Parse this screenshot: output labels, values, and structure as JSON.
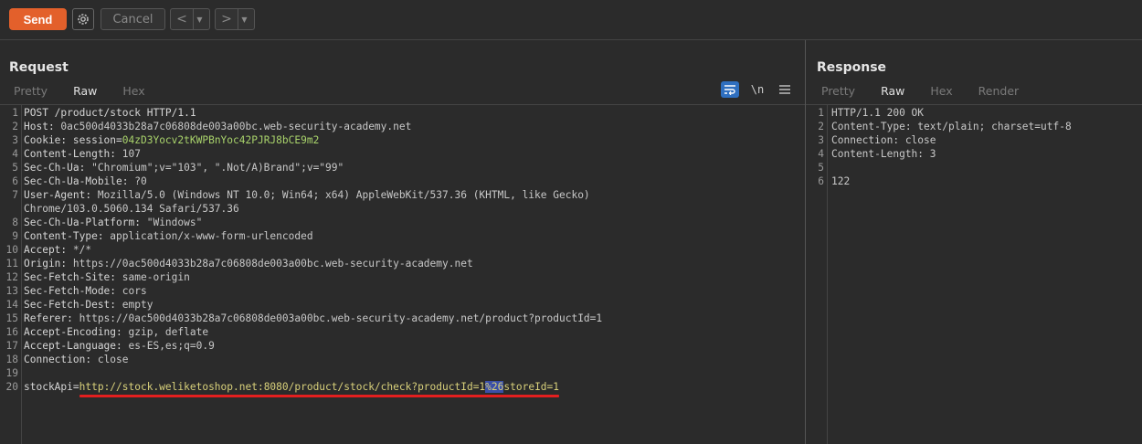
{
  "toolbar": {
    "send_label": "Send",
    "cancel_label": "Cancel",
    "back_glyph": "<",
    "forward_glyph": ">",
    "dropdown_glyph": "▼",
    "settings_icon": "gear-icon"
  },
  "colors": {
    "accent": "#e3602b",
    "background": "#2b2b2b",
    "highlight": "#3a4fa8",
    "underline": "#e31f1f",
    "cookie_value": "#a9d36b",
    "param_value": "#d8d07a"
  },
  "request": {
    "title": "Request",
    "tabs": [
      "Pretty",
      "Raw",
      "Hex"
    ],
    "active_tab": "Raw",
    "newline_toggle": "\\n",
    "lines": [
      {
        "n": "1",
        "key": "POST /product/stock HTTP/1.1",
        "val": ""
      },
      {
        "n": "2",
        "key": "Host:",
        "val": " 0ac500d4033b28a7c06808de003a00bc.web-security-academy.net"
      },
      {
        "n": "3",
        "key": "Cookie: session=",
        "val": "",
        "cookie": "04zD3Yocv2tKWPBnYoc42PJRJ8bCE9m2"
      },
      {
        "n": "4",
        "key": "Content-Length:",
        "val": " 107"
      },
      {
        "n": "5",
        "key": "Sec-Ch-Ua:",
        "val": " \"Chromium\";v=\"103\", \".Not/A)Brand\";v=\"99\""
      },
      {
        "n": "6",
        "key": "Sec-Ch-Ua-Mobile:",
        "val": " ?0"
      },
      {
        "n": "7",
        "key": "User-Agent:",
        "val": " Mozilla/5.0 (Windows NT 10.0; Win64; x64) AppleWebKit/537.36 (KHTML, like Gecko)"
      },
      {
        "n": "",
        "key": "",
        "val": "Chrome/103.0.5060.134 Safari/537.36"
      },
      {
        "n": "8",
        "key": "Sec-Ch-Ua-Platform:",
        "val": " \"Windows\""
      },
      {
        "n": "9",
        "key": "Content-Type:",
        "val": " application/x-www-form-urlencoded"
      },
      {
        "n": "10",
        "key": "Accept:",
        "val": " */*"
      },
      {
        "n": "11",
        "key": "Origin:",
        "val": " https://0ac500d4033b28a7c06808de003a00bc.web-security-academy.net"
      },
      {
        "n": "12",
        "key": "Sec-Fetch-Site:",
        "val": " same-origin"
      },
      {
        "n": "13",
        "key": "Sec-Fetch-Mode:",
        "val": " cors"
      },
      {
        "n": "14",
        "key": "Sec-Fetch-Dest:",
        "val": " empty"
      },
      {
        "n": "15",
        "key": "Referer:",
        "val": " https://0ac500d4033b28a7c06808de003a00bc.web-security-academy.net/product?productId=1"
      },
      {
        "n": "16",
        "key": "Accept-Encoding:",
        "val": " gzip, deflate"
      },
      {
        "n": "17",
        "key": "Accept-Language:",
        "val": " es-ES,es;q=0.9"
      },
      {
        "n": "18",
        "key": "Connection:",
        "val": " close"
      },
      {
        "n": "19",
        "key": "",
        "val": ""
      },
      {
        "n": "20",
        "key": "stockApi=",
        "val": "",
        "body_pre": "http://stock.weliketoshop.net:8080/product/stock/check?productId=1",
        "body_hl": "%26",
        "body_post": "storeId=1"
      }
    ]
  },
  "response": {
    "title": "Response",
    "tabs": [
      "Pretty",
      "Raw",
      "Hex",
      "Render"
    ],
    "active_tab": "Raw",
    "lines": [
      {
        "n": "1",
        "text": "HTTP/1.1 200 OK"
      },
      {
        "n": "2",
        "text": "Content-Type: text/plain; charset=utf-8"
      },
      {
        "n": "3",
        "text": "Connection: close"
      },
      {
        "n": "4",
        "text": "Content-Length: 3"
      },
      {
        "n": "5",
        "text": ""
      },
      {
        "n": "6",
        "text": "122"
      }
    ]
  }
}
